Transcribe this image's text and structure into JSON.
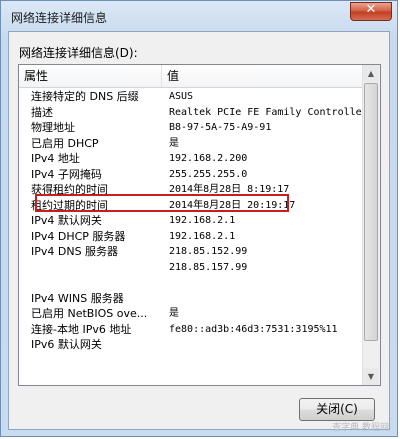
{
  "window": {
    "title": "网络连接详细信息"
  },
  "section_label": "网络连接详细信息(D):",
  "list": {
    "header_property": "属性",
    "header_value": "值",
    "rows": [
      {
        "property": "连接特定的 DNS 后缀",
        "value": "ASUS"
      },
      {
        "property": "描述",
        "value": "Realtek PCIe FE Family Controller"
      },
      {
        "property": "物理地址",
        "value": "B8-97-5A-75-A9-91"
      },
      {
        "property": "已启用 DHCP",
        "value": "是"
      },
      {
        "property": "IPv4 地址",
        "value": "192.168.2.200"
      },
      {
        "property": "IPv4 子网掩码",
        "value": "255.255.255.0"
      },
      {
        "property": "获得租约的时间",
        "value": "2014年8月28日 8:19:17"
      },
      {
        "property": "租约过期的时间",
        "value": "2014年8月28日 20:19:17"
      },
      {
        "property": "IPv4 默认网关",
        "value": "192.168.2.1"
      },
      {
        "property": "IPv4 DHCP 服务器",
        "value": "192.168.2.1"
      },
      {
        "property": "IPv4 DNS 服务器",
        "value": "218.85.152.99"
      },
      {
        "property": "",
        "value": "218.85.157.99"
      },
      {
        "property": "",
        "value": ""
      },
      {
        "property": "IPv4 WINS 服务器",
        "value": ""
      },
      {
        "property": "已启用 NetBIOS ove...",
        "value": "是"
      },
      {
        "property": "连接-本地 IPv6 地址",
        "value": "fe80::ad3b:46d3:7531:3195%11"
      },
      {
        "property": "IPv6 默认网关",
        "value": ""
      }
    ]
  },
  "close_button_label": "关闭(C)",
  "watermark_text": "查字典 教程网"
}
